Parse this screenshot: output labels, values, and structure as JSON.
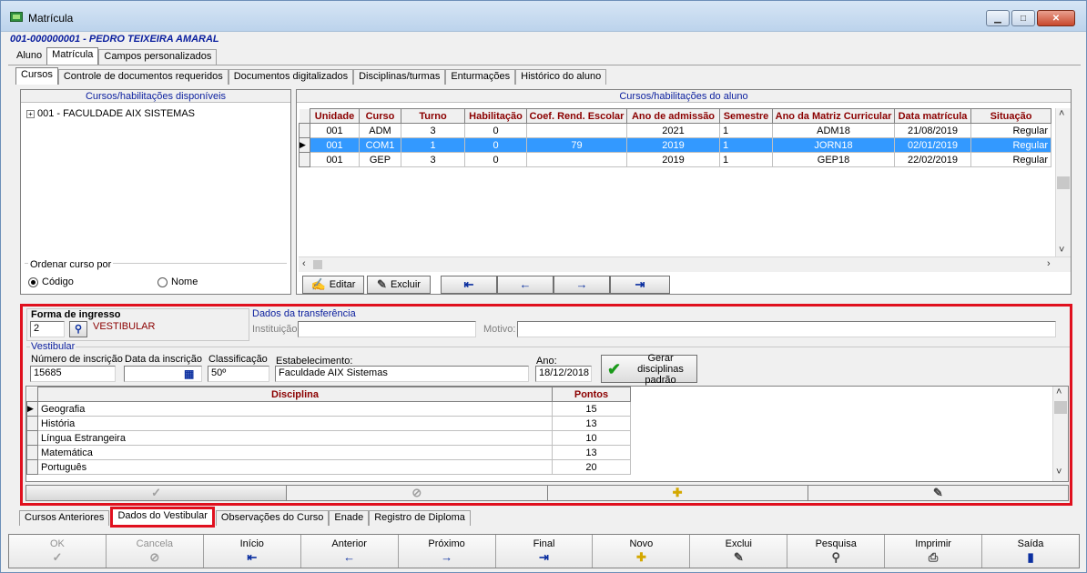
{
  "window": {
    "title": "Matrícula",
    "student": "001-000000001 - PEDRO TEIXEIRA AMARAL"
  },
  "top_tabs": [
    "Aluno",
    "Matrícula",
    "Campos personalizados"
  ],
  "sub_tabs": [
    "Cursos",
    "Controle de documentos requeridos",
    "Documentos digitalizados",
    "Disciplinas/turmas",
    "Enturmações",
    "Histórico do aluno"
  ],
  "available": {
    "header": "Cursos/habilitações disponíveis",
    "tree_item": "001 - FACULDADE AIX SISTEMAS",
    "order_label": "Ordenar curso por",
    "order_codigo": "Código",
    "order_nome": "Nome"
  },
  "student_courses": {
    "header": "Cursos/habilitações do aluno",
    "columns": [
      "Unidade",
      "Curso",
      "Turno",
      "Habilitação",
      "Coef. Rend. Escolar",
      "Ano de admissão",
      "Semestre",
      "Ano da Matriz Curricular",
      "Data matrícula",
      "Situação"
    ],
    "rows": [
      [
        "001",
        "ADM",
        "3",
        "0",
        "",
        "2021",
        "1",
        "ADM18",
        "21/08/2019",
        "Regular"
      ],
      [
        "001",
        "COM1",
        "1",
        "0",
        "79",
        "2019",
        "1",
        "JORN18",
        "02/01/2019",
        "Regular"
      ],
      [
        "001",
        "GEP",
        "3",
        "0",
        "",
        "2019",
        "1",
        "GEP18",
        "22/02/2019",
        "Regular"
      ]
    ],
    "edit_label": "Editar",
    "delete_label": "Excluir"
  },
  "ingresso": {
    "title": "Forma de ingresso",
    "code": "2",
    "type": "VESTIBULAR",
    "transfer_title": "Dados da transferência",
    "institution_label": "Instituição:",
    "reason_label": "Motivo:"
  },
  "vestibular": {
    "legend": "Vestibular",
    "numero_label": "Número de inscrição",
    "numero_value": "15685",
    "data_label": "Data da inscrição",
    "data_value": "",
    "class_label": "Classificação",
    "class_value": "50º",
    "estab_label": "Estabelecimento:",
    "estab_value": "Faculdade AIX Sistemas",
    "ano_label": "Ano:",
    "ano_value": "18/12/2018",
    "gerar_line1": "Gerar disciplinas",
    "gerar_line2": "padrão"
  },
  "disciplinas": {
    "col_disciplina": "Disciplina",
    "col_pontos": "Pontos",
    "rows": [
      [
        "Geografia",
        "15"
      ],
      [
        "História",
        "13"
      ],
      [
        "Língua Estrangeira",
        "10"
      ],
      [
        "Matemática",
        "13"
      ],
      [
        "Português",
        "20"
      ]
    ]
  },
  "bottom_tabs": [
    "Cursos Anteriores",
    "Dados do Vestibular",
    "Observações do Curso",
    "Enade",
    "Registro de Diploma"
  ],
  "nav": [
    {
      "label": "OK",
      "icon": "✓"
    },
    {
      "label": "Cancela",
      "icon": "⊘"
    },
    {
      "label": "Início",
      "icon": "⇤"
    },
    {
      "label": "Anterior",
      "icon": "←"
    },
    {
      "label": "Próximo",
      "icon": "→"
    },
    {
      "label": "Final",
      "icon": "⇥"
    },
    {
      "label": "Novo",
      "icon": "✚"
    },
    {
      "label": "Exclui",
      "icon": "✎"
    },
    {
      "label": "Pesquisa",
      "icon": "⚲"
    },
    {
      "label": "Imprimir",
      "icon": "⎙"
    },
    {
      "label": "Saída",
      "icon": "▮"
    }
  ],
  "colors": {
    "accent_red": "#e0101e",
    "title_blue": "#0a1e9e",
    "header_red": "#8b0000",
    "selection": "#3399ff"
  }
}
